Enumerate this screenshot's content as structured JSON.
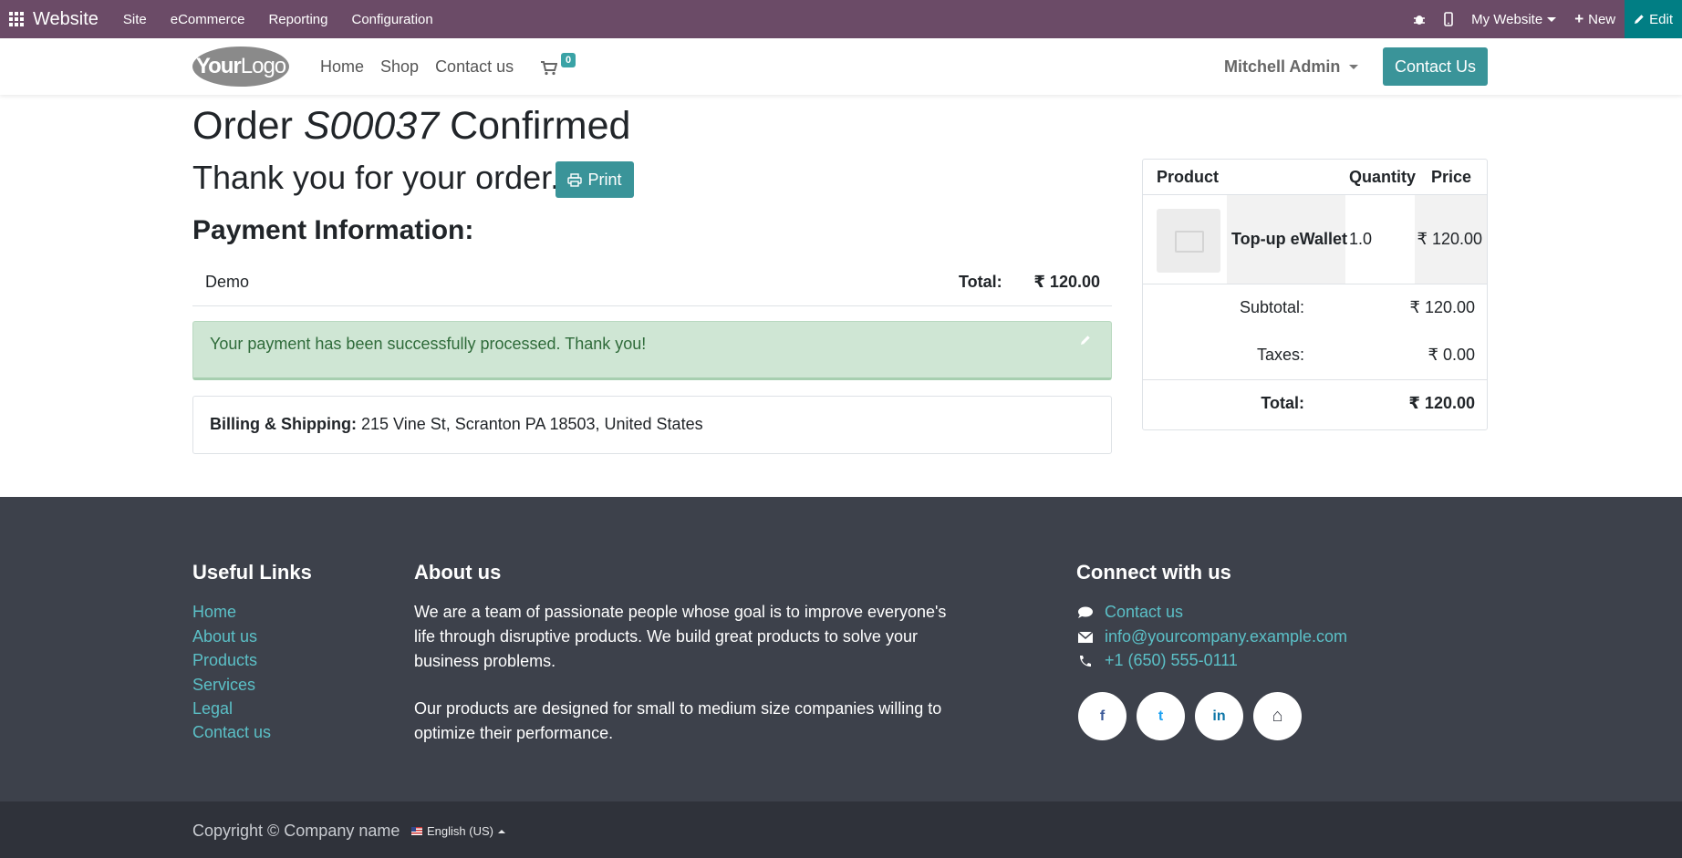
{
  "admin_bar": {
    "brand": "Website",
    "menu": [
      "Site",
      "eCommerce",
      "Reporting",
      "Configuration"
    ],
    "website_selector": "My Website",
    "new_label": "New",
    "edit_label": "Edit"
  },
  "site_header": {
    "logo_text_bold": "Your",
    "logo_text": "Logo",
    "nav": [
      "Home",
      "Shop",
      "Contact us"
    ],
    "cart_count": "0",
    "user": "Mitchell Admin",
    "contact_button": "Contact Us"
  },
  "order": {
    "title_prefix": "Order",
    "number": "S00037",
    "title_suffix": "Confirmed",
    "thanks": "Thank you for your order.",
    "print_label": "Print",
    "payment_heading": "Payment Information:",
    "payment_method": "Demo",
    "total_label": "Total:",
    "total_value": "₹ 120.00",
    "success_message": "Your payment has been successfully processed. Thank you!",
    "billing_label": "Billing & Shipping:",
    "billing_address": " 215 Vine St, Scranton PA 18503, United States"
  },
  "summary": {
    "headers": {
      "product": "Product",
      "quantity": "Quantity",
      "price": "Price"
    },
    "items": [
      {
        "name": "Top-up eWallet",
        "quantity": "1.0",
        "price": "₹ 120.00"
      }
    ],
    "subtotal_label": "Subtotal:",
    "subtotal_value": "₹ 120.00",
    "taxes_label": "Taxes:",
    "taxes_value": "₹ 0.00",
    "total_label": "Total:",
    "total_value": "₹ 120.00"
  },
  "footer": {
    "useful_links_title": "Useful Links",
    "useful_links": [
      "Home",
      "About us",
      "Products",
      "Services",
      "Legal",
      "Contact us"
    ],
    "about_title": "About us",
    "about_p1_line1": "We are a team of passionate people whose goal is to improve everyone's",
    "about_p1_line2": "life through disruptive products. We build great products to solve your",
    "about_p1_line3": "business problems.",
    "about_p2_line1": "Our products are designed for small to medium size companies willing to",
    "about_p2_line2": "optimize their performance.",
    "connect_title": "Connect with us",
    "contact_link": "Contact us",
    "email": "info@yourcompany.example.com",
    "phone": "+1 (650) 555-0111",
    "social": [
      {
        "name": "facebook",
        "glyph": "f",
        "color": "#3b5998"
      },
      {
        "name": "twitter",
        "glyph": "t",
        "color": "#1da1f2"
      },
      {
        "name": "linkedin",
        "glyph": "in",
        "color": "#0e76a8"
      },
      {
        "name": "home",
        "glyph": "⌂",
        "color": "#3d414b"
      }
    ]
  },
  "bottom_bar": {
    "copyright": "Copyright © Company name",
    "language": "English (US)"
  }
}
